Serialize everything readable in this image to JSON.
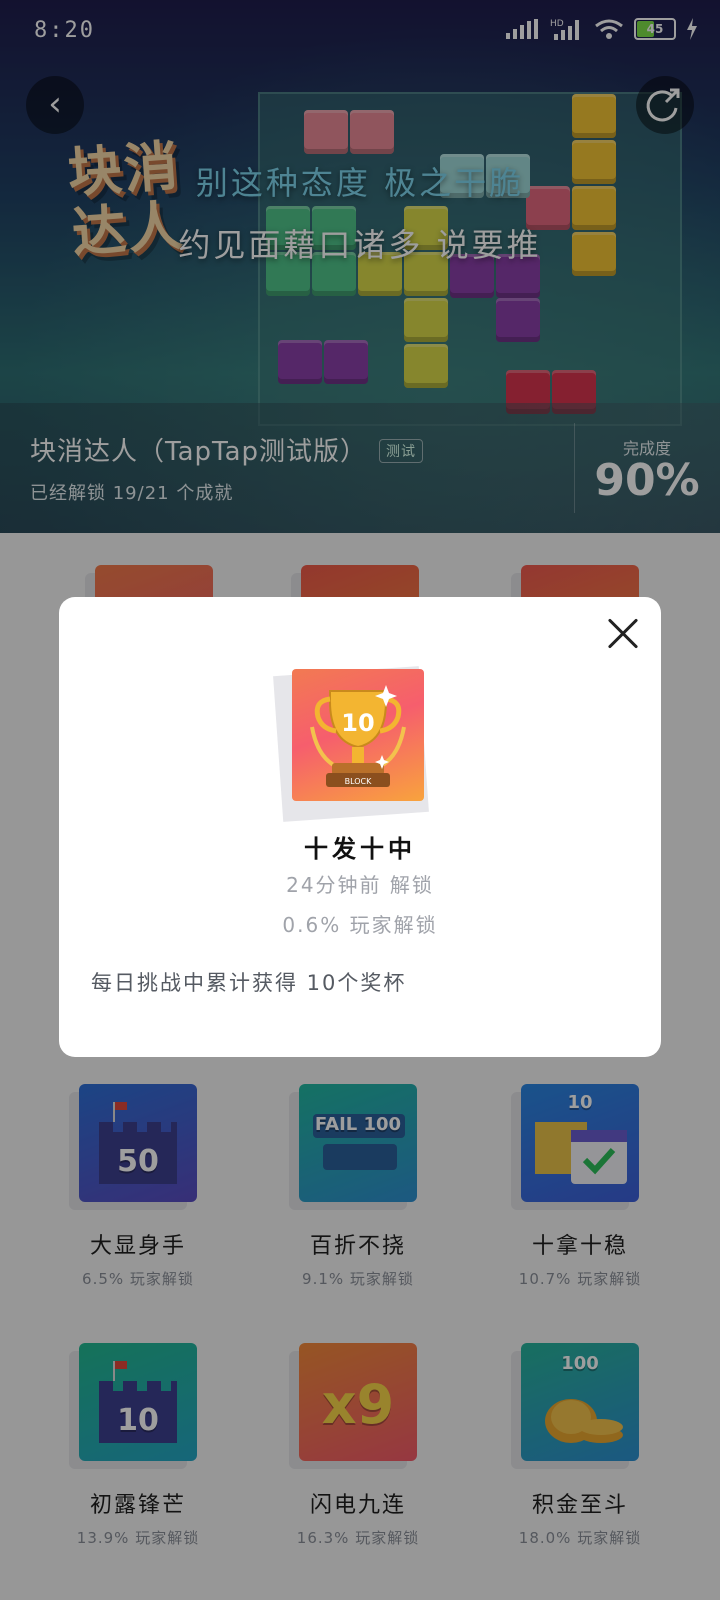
{
  "status_bar": {
    "time": "8:20",
    "network_badge": "HD",
    "battery_level": "45"
  },
  "hero": {
    "logo_text": "块消达人",
    "lyric_line1": "别这种态度 极之干脆",
    "lyric_line2": "约见面藉口诸多 说要推"
  },
  "header": {
    "game_name": "块消达人（TapTap测试版）",
    "beta_tag": "测试",
    "unlock_summary": "已经解锁 19/21 个成就",
    "completion_label": "完成度",
    "completion_value": "90%"
  },
  "achievements": [
    {
      "name": "大显身手",
      "rate": "6.5% 玩家解锁",
      "icon": "castle-50-icon",
      "badge_text": "50",
      "colors": [
        "#2d6fd6",
        "#5a4cc0"
      ]
    },
    {
      "name": "百折不挠",
      "rate": "9.1% 玩家解锁",
      "icon": "fail-banner-icon",
      "badge_text": "FAIL 100",
      "colors": [
        "#22b7a0",
        "#2f8fd0"
      ]
    },
    {
      "name": "十拿十稳",
      "rate": "10.7% 玩家解锁",
      "icon": "calendar-check-icon",
      "badge_text": "10",
      "colors": [
        "#2a86e0",
        "#3e5ed8"
      ]
    },
    {
      "name": "初露锋芒",
      "rate": "13.9% 玩家解锁",
      "icon": "castle-10-icon",
      "badge_text": "10",
      "colors": [
        "#22b890",
        "#25a5c4"
      ]
    },
    {
      "name": "闪电九连",
      "rate": "16.3% 玩家解锁",
      "icon": "x9-icon",
      "badge_text": "x9",
      "colors": [
        "#f28a3a",
        "#f25a6a"
      ]
    },
    {
      "name": "积金至斗",
      "rate": "18.0% 玩家解锁",
      "icon": "coin-stack-icon",
      "badge_text": "100",
      "colors": [
        "#28b39a",
        "#2d8fd0"
      ]
    }
  ],
  "dialog": {
    "badge_icon": "trophy-10-icon",
    "badge_number": "10",
    "badge_plate": "BLOCK",
    "title": "十发十中",
    "unlock_time": "24分钟前 解锁",
    "unlock_rate": "0.6% 玩家解锁",
    "description": "每日挑战中累计获得 10个奖杯"
  }
}
